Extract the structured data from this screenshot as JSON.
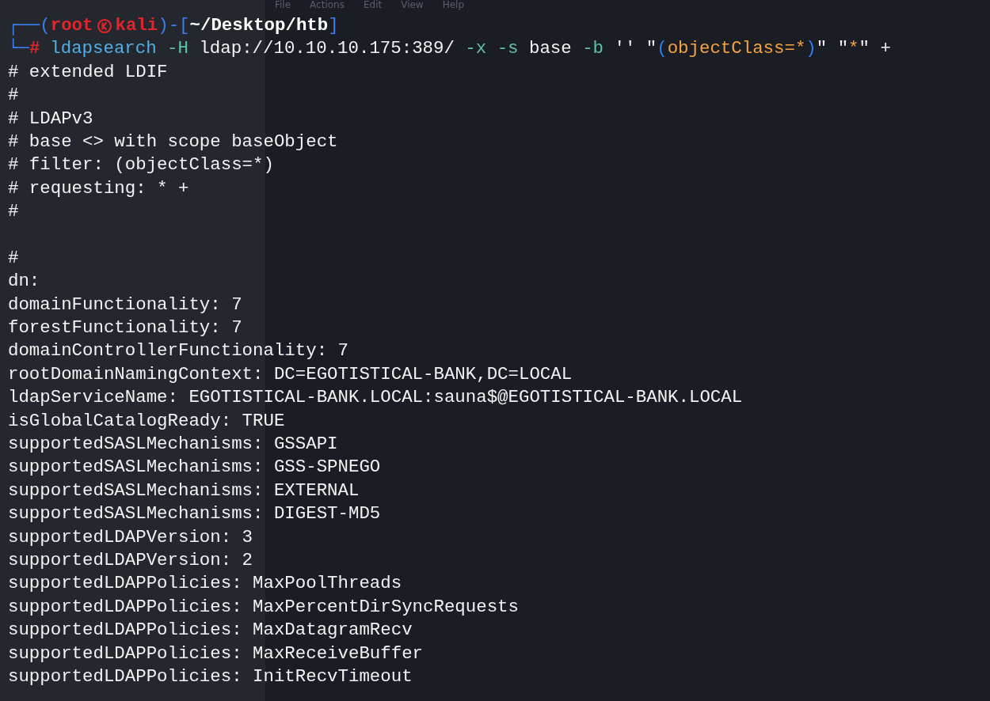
{
  "background_window": {
    "menu": [
      "File",
      "Actions",
      "Edit",
      "View",
      "Help"
    ]
  },
  "prompt": {
    "user": "root",
    "host": "kali",
    "path": "~/Desktop/htb",
    "symbol": "#",
    "frame": [
      "┌──(",
      ")-[",
      "]",
      "└─"
    ],
    "command": [
      {
        "kind": "command",
        "text": "ldapsearch"
      },
      {
        "kind": "option",
        "text": " -H"
      },
      {
        "kind": "arg",
        "text": " ldap://10.10.10.175:389/"
      },
      {
        "kind": "option",
        "text": " -x -s"
      },
      {
        "kind": "arg",
        "text": " base"
      },
      {
        "kind": "option",
        "text": " -b"
      },
      {
        "kind": "arg",
        "text": " '' \""
      },
      {
        "kind": "paren",
        "text": "("
      },
      {
        "kind": "string",
        "text": "objectClass=*"
      },
      {
        "kind": "paren",
        "text": ")"
      },
      {
        "kind": "arg",
        "text": "\" \""
      },
      {
        "kind": "string",
        "text": "*"
      },
      {
        "kind": "arg",
        "text": "\" +"
      }
    ]
  },
  "header": [
    "# extended LDIF",
    "#",
    "# LDAPv3",
    "# base <> with scope baseObject",
    "# filter: (objectClass=*)",
    "# requesting: * +",
    "#"
  ],
  "output": [
    "#",
    "dn:",
    "domainFunctionality: 7",
    "forestFunctionality: 7",
    "domainControllerFunctionality: 7",
    "rootDomainNamingContext: DC=EGOTISTICAL-BANK,DC=LOCAL",
    "ldapServiceName: EGOTISTICAL-BANK.LOCAL:sauna$@EGOTISTICAL-BANK.LOCAL",
    "isGlobalCatalogReady: TRUE",
    "supportedSASLMechanisms: GSSAPI",
    "supportedSASLMechanisms: GSS-SPNEGO",
    "supportedSASLMechanisms: EXTERNAL",
    "supportedSASLMechanisms: DIGEST-MD5",
    "supportedLDAPVersion: 3",
    "supportedLDAPVersion: 2",
    "supportedLDAPPolicies: MaxPoolThreads",
    "supportedLDAPPolicies: MaxPercentDirSyncRequests",
    "supportedLDAPPolicies: MaxDatagramRecv",
    "supportedLDAPPolicies: MaxReceiveBuffer",
    "supportedLDAPPolicies: InitRecvTimeout"
  ]
}
